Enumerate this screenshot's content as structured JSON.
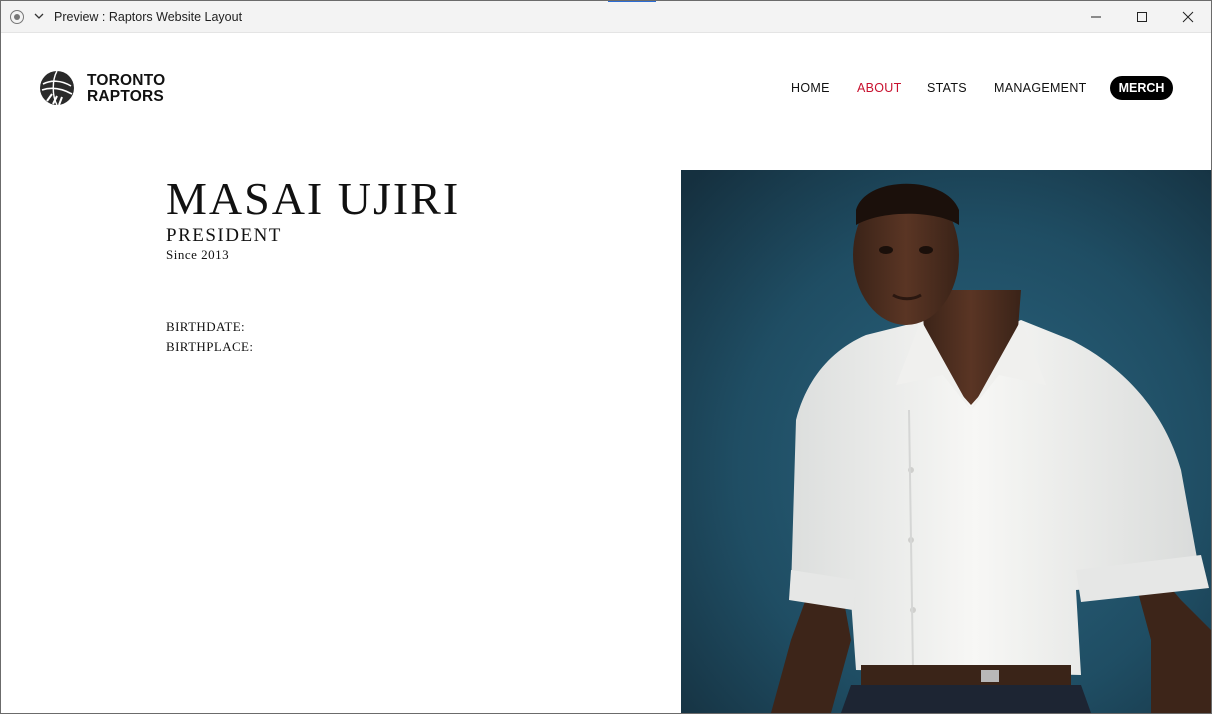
{
  "window": {
    "title": "Preview : Raptors Website Layout"
  },
  "site": {
    "brand_line1": "TORONTO",
    "brand_line2": "RAPTORS",
    "nav": {
      "home": "HOME",
      "about": "ABOUT",
      "stats": "STATS",
      "management": "MANAGEMENT",
      "merch": "MERCH"
    },
    "active_nav": "about"
  },
  "profile": {
    "name": "MASAI UJIRI",
    "role": "PRESIDENT",
    "since": "Since 2013",
    "birthdate_label": "BIRTHDATE:",
    "birthplace_label": "BIRTHPLACE:"
  },
  "colors": {
    "accent": "#c8102e",
    "merch_bg": "#000000",
    "portrait_bg": "#1f4d63",
    "shirt": "#f2f2f0"
  },
  "icons": {
    "logo": "raptors-ball-icon",
    "window_controls": [
      "minimize-icon",
      "maximize-icon",
      "close-icon"
    ]
  }
}
